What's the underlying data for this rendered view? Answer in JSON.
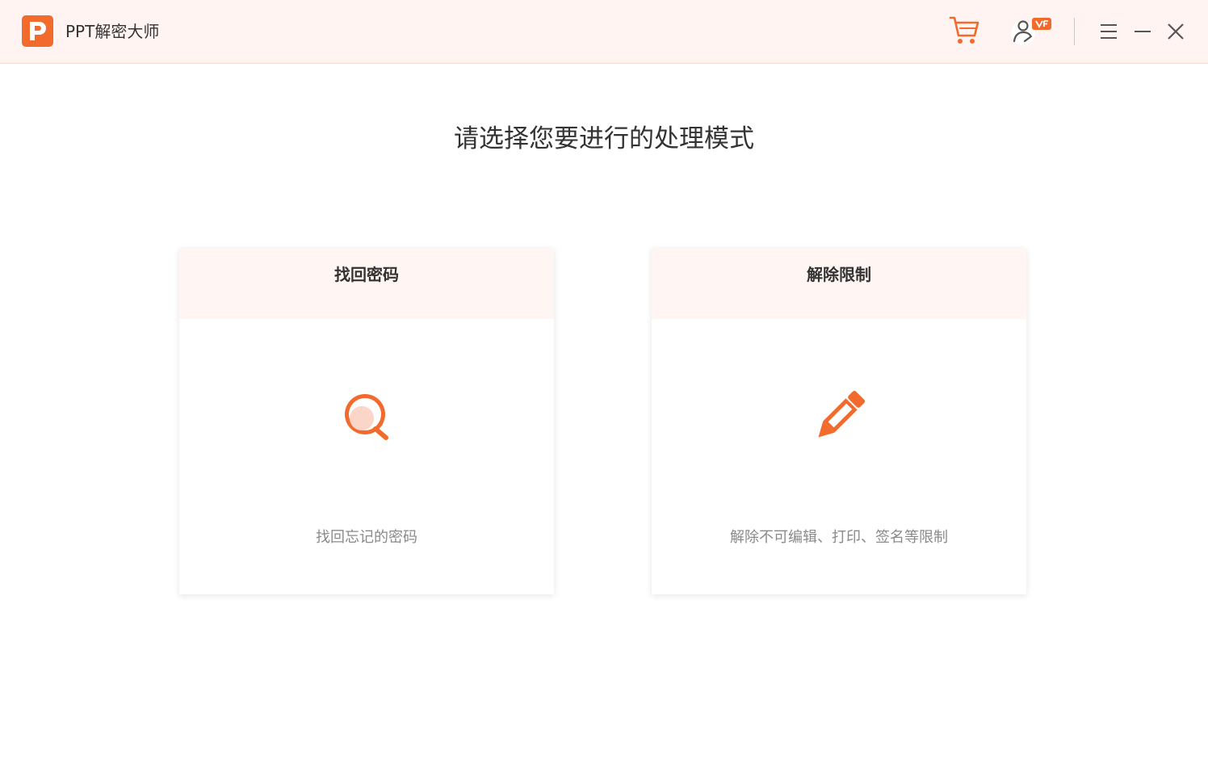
{
  "app": {
    "title": "PPT解密大师",
    "accent_color": "#f26a2c",
    "logo_letter": "P"
  },
  "titlebar": {
    "icons": [
      "cart-icon",
      "user-vip-icon",
      "menu-icon",
      "minimize-icon",
      "close-icon"
    ]
  },
  "main": {
    "heading": "请选择您要进行的处理模式",
    "cards": [
      {
        "title": "找回密码",
        "icon": "magnifier-icon",
        "description": "找回忘记的密码"
      },
      {
        "title": "解除限制",
        "icon": "pencil-icon",
        "description": "解除不可编辑、打印、签名等限制"
      }
    ]
  }
}
